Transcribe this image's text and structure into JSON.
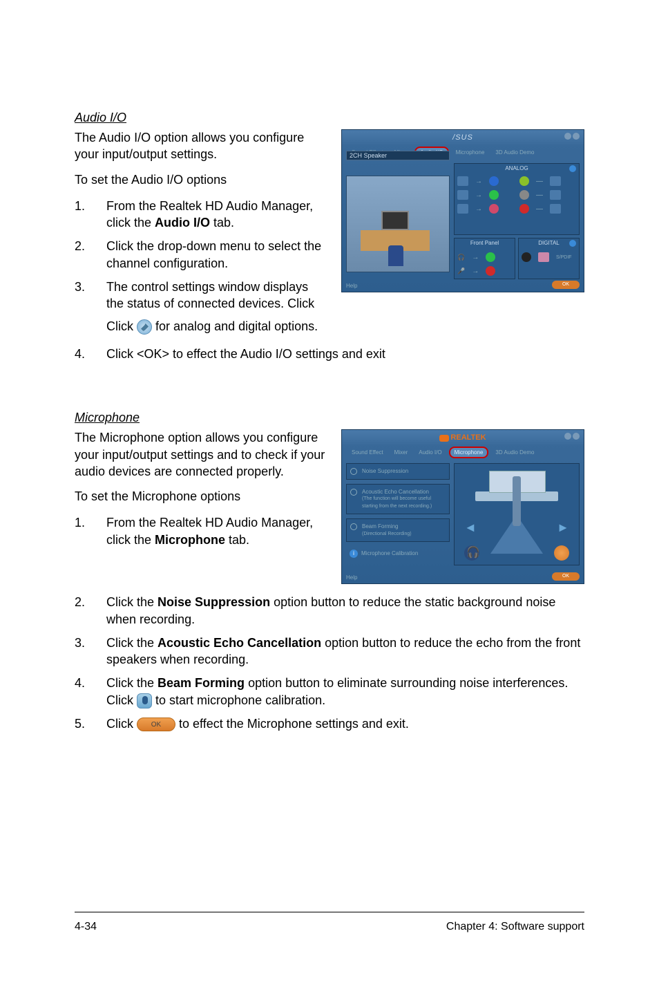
{
  "section_audio": {
    "heading": "Audio I/O",
    "intro": "The Audio I/O option allows you configure your input/output settings.",
    "subintro": "To set the Audio I/O options",
    "steps": [
      {
        "num": "1.",
        "pre": "From the Realtek HD Audio Manager, click the ",
        "bold": "Audio I/O",
        "post": " tab."
      },
      {
        "num": "2.",
        "text": "Click the drop-down menu to select the channel configuration."
      },
      {
        "num": "3.",
        "pre": "The control settings window displays the status of connected devices. Click ",
        "icon": "wrench",
        "post": " for analog and digital options."
      },
      {
        "num": "4.",
        "text": "Click <OK> to effect the Audio I/O settings and exit"
      }
    ],
    "ss": {
      "brand": "/SUS",
      "tabs": [
        "Sound Effect",
        "Mixer",
        "Audio I/O",
        "Microphone",
        "3D Audio Demo"
      ],
      "active_tab": 2,
      "dropdown": "2CH Speaker",
      "panel1": "ANALOG",
      "panel2": "Front Panel",
      "panel3": "DIGITAL",
      "help": "Help",
      "ok": "OK"
    }
  },
  "section_mic": {
    "heading": "Microphone",
    "intro": "The Microphone option allows you configure your input/output settings and to check if your audio devices are connected properly.",
    "subintro": "To set the Microphone options",
    "steps": [
      {
        "num": "1.",
        "pre": "From the Realtek HD Audio Manager, click the ",
        "bold": "Microphone",
        "post": " tab."
      },
      {
        "num": "2.",
        "pre": "Click the ",
        "bold": "Noise Suppression",
        "post": " option button to reduce the static background noise when recording."
      },
      {
        "num": "3.",
        "pre": "Click the ",
        "bold": "Acoustic Echo Cancellation",
        "post": " option button to reduce the echo from the front speakers when recording."
      },
      {
        "num": "4.",
        "pre": "Click the ",
        "bold": "Beam Forming",
        "post_a": " option button to eliminate surrounding noise interferences. Click ",
        "icon": "mic",
        "post_b": " to start microphone calibration."
      },
      {
        "num": "5.",
        "pre": "Click ",
        "btn": "OK",
        "post": " to effect the Microphone settings and exit."
      }
    ],
    "ss": {
      "brand": "REALTEK",
      "tabs": [
        "Sound Effect",
        "Mixer",
        "Audio I/O",
        "Microphone",
        "3D Audio Demo"
      ],
      "active_tab": 3,
      "opt1": "Noise Suppression",
      "opt2": "Acoustic Echo Cancellation",
      "opt2_sub": "(The function will become useful starting from the next recording.)",
      "opt3": "Beam Forming",
      "opt3_sub": "(Directional Recording)",
      "opt4": "Microphone Calibration",
      "help": "Help",
      "ok": "OK"
    }
  },
  "footer": {
    "left": "4-34",
    "right": "Chapter 4: Software support"
  }
}
